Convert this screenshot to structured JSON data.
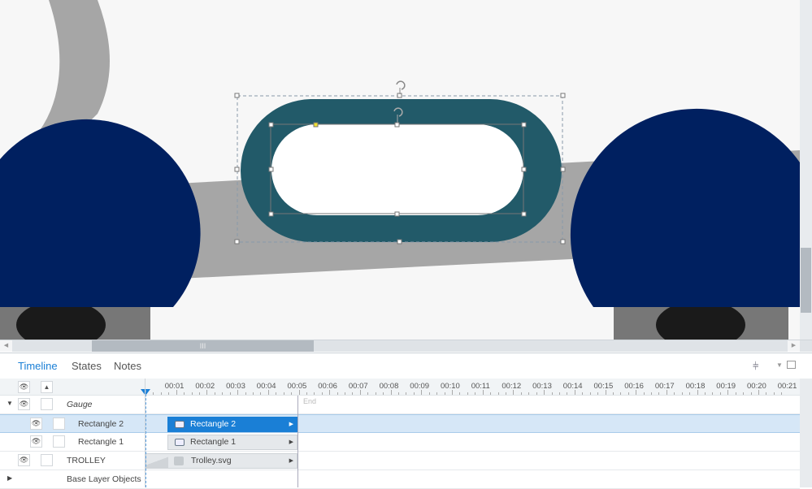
{
  "timeline": {
    "tabs": [
      "Timeline",
      "States",
      "Notes"
    ],
    "active_tab": "Timeline",
    "ticks": [
      "00:01",
      "00:02",
      "00:03",
      "00:04",
      "00:05",
      "00:06",
      "00:07",
      "00:08",
      "00:09",
      "00:10",
      "00:11",
      "00:12",
      "00:13",
      "00:14",
      "00:15",
      "00:16",
      "00:17",
      "00:18",
      "00:19",
      "00:20",
      "00:21"
    ],
    "end_label": "End",
    "layers": [
      {
        "name": "Gauge",
        "bar": ""
      },
      {
        "name": "Rectangle 2",
        "bar": "Rectangle 2",
        "selected": true
      },
      {
        "name": "Rectangle 1",
        "bar": "Rectangle 1"
      },
      {
        "name": "TROLLEY",
        "bar": "Trolley.svg"
      },
      {
        "name": "Base Layer Objects",
        "bar": ""
      }
    ]
  },
  "scrollbar": {
    "grip": "III"
  },
  "colors": {
    "accent": "#1a7fd6",
    "gauge": "#225a69",
    "navy": "#002060"
  }
}
